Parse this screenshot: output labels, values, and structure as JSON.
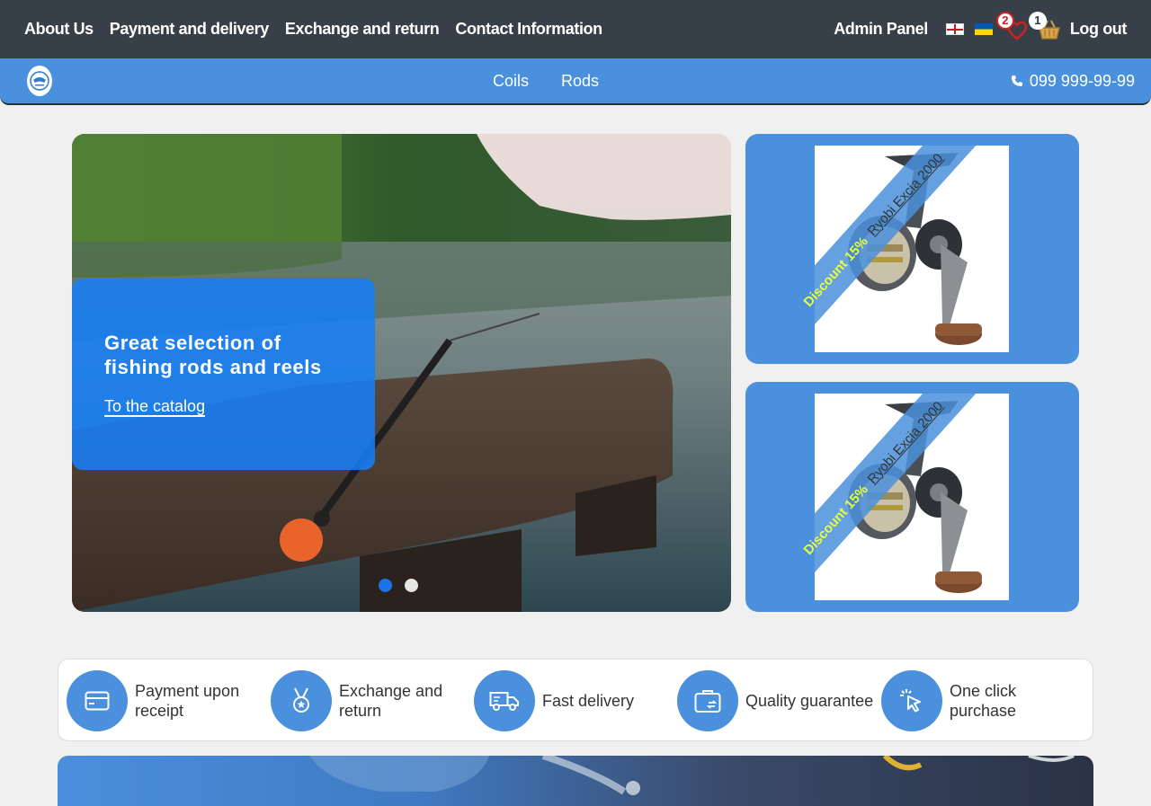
{
  "topbar": {
    "nav": [
      "About Us",
      "Payment and delivery",
      "Exchange and return",
      "Contact Information"
    ],
    "admin_label": "Admin Panel",
    "favorites_count": "2",
    "cart_count": "1",
    "logout_label": "Log out"
  },
  "navbar": {
    "categories": [
      "Coils",
      "Rods"
    ],
    "phone": "099 999-99-99"
  },
  "hero": {
    "title_line1": "Great selection of",
    "title_line2": "fishing rods and reels",
    "link_label": "To the catalog",
    "slide_count": 2,
    "active_slide": 1
  },
  "promos": [
    {
      "discount": "Discount 15%",
      "product": "Ryobi Excia 2000"
    },
    {
      "discount": "Discount 15%",
      "product": "Ryobi Excia 2000"
    }
  ],
  "features": [
    {
      "label": "Payment upon receipt",
      "icon": "card-icon"
    },
    {
      "label": "Exchange and return",
      "icon": "medal-icon"
    },
    {
      "label": "Fast delivery",
      "icon": "truck-icon"
    },
    {
      "label": "Quality guarantee",
      "icon": "briefcase-icon"
    },
    {
      "label": "One click purchase",
      "icon": "cursor-click-icon"
    }
  ],
  "colors": {
    "topbar": "#373f49",
    "accent_blue": "#4a90dc",
    "hero_card": "#167ef5",
    "discount_text": "#e8ff3c"
  }
}
